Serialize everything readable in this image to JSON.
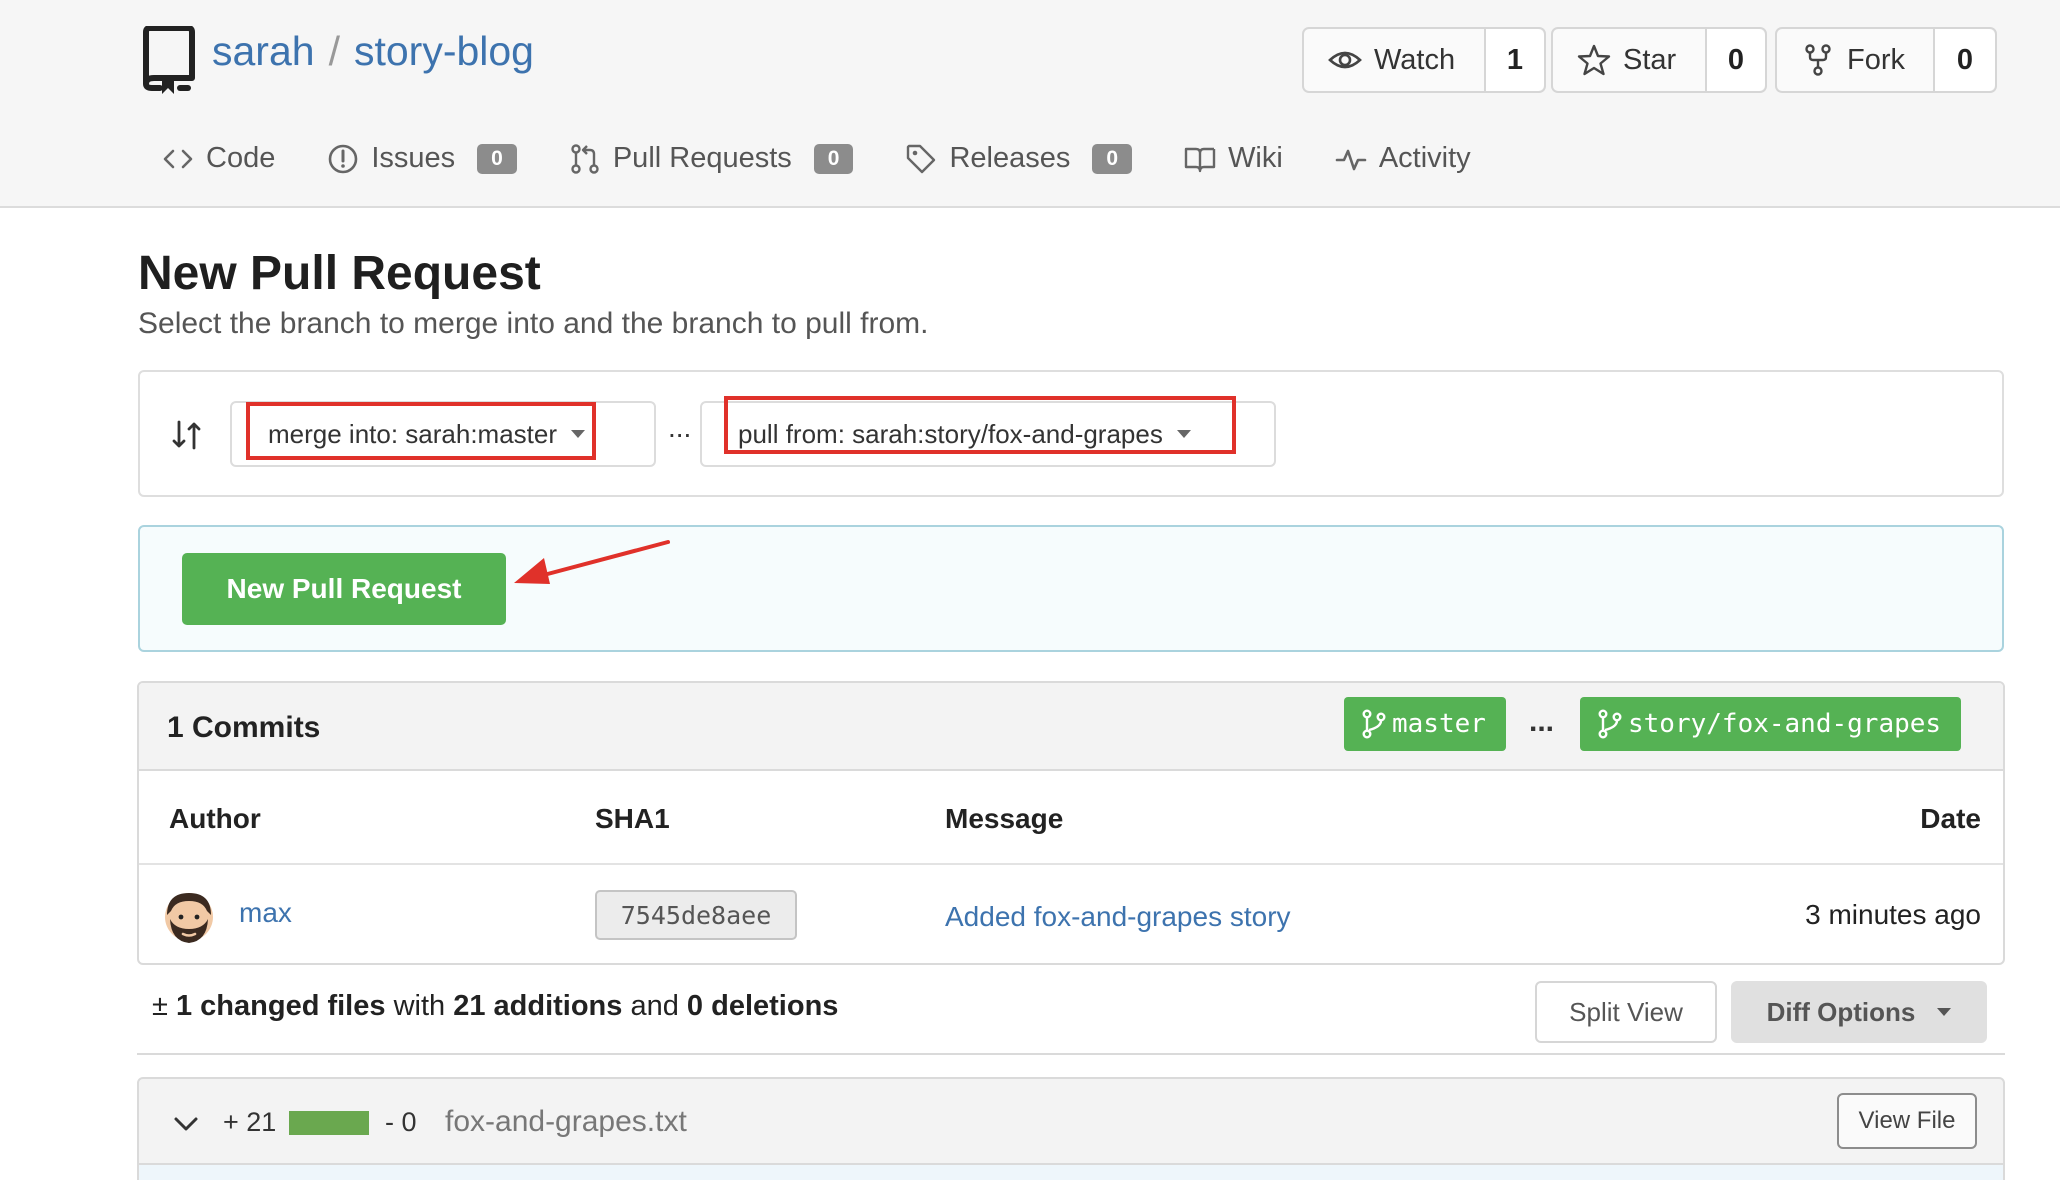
{
  "repo": {
    "owner": "sarah",
    "separator": "/",
    "name": "story-blog"
  },
  "actions": {
    "watch": {
      "label": "Watch",
      "count": "1"
    },
    "star": {
      "label": "Star",
      "count": "0"
    },
    "fork": {
      "label": "Fork",
      "count": "0"
    }
  },
  "tabs": [
    {
      "label": "Code",
      "icon": "code-icon"
    },
    {
      "label": "Issues",
      "icon": "issue-icon",
      "badge": "0"
    },
    {
      "label": "Pull Requests",
      "icon": "pull-request-icon",
      "badge": "0"
    },
    {
      "label": "Releases",
      "icon": "tag-icon",
      "badge": "0"
    },
    {
      "label": "Wiki",
      "icon": "book-icon"
    },
    {
      "label": "Activity",
      "icon": "pulse-icon"
    }
  ],
  "page": {
    "title": "New Pull Request",
    "subtitle": "Select the branch to merge into and the branch to pull from."
  },
  "branches": {
    "merge_into": "merge into: sarah:master",
    "dots": "...",
    "pull_from": "pull from: sarah:story/fox-and-grapes"
  },
  "cta": {
    "label": "New Pull Request"
  },
  "commits": {
    "title": "1 Commits",
    "base_branch": "master",
    "head_branch": "story/fox-and-grapes",
    "dots": "...",
    "columns": {
      "author": "Author",
      "sha": "SHA1",
      "message": "Message",
      "date": "Date"
    },
    "rows": [
      {
        "author": "max",
        "sha": "7545de8aee",
        "message": "Added fox-and-grapes story",
        "date": "3 minutes ago"
      }
    ]
  },
  "diff": {
    "stat_icon": "±",
    "changed": "1 changed files",
    "with": "with",
    "additions": "21 additions",
    "and": "and",
    "deletions": "0 deletions",
    "split_view": "Split View",
    "diff_options": "Diff Options"
  },
  "file": {
    "additions": "+ 21",
    "deletions": "- 0",
    "name": "fox-and-grapes.txt",
    "view_file": "View File"
  },
  "colors": {
    "accent_green": "#55b254",
    "link_blue": "#3d73ae",
    "highlight_red": "#e0312a"
  }
}
